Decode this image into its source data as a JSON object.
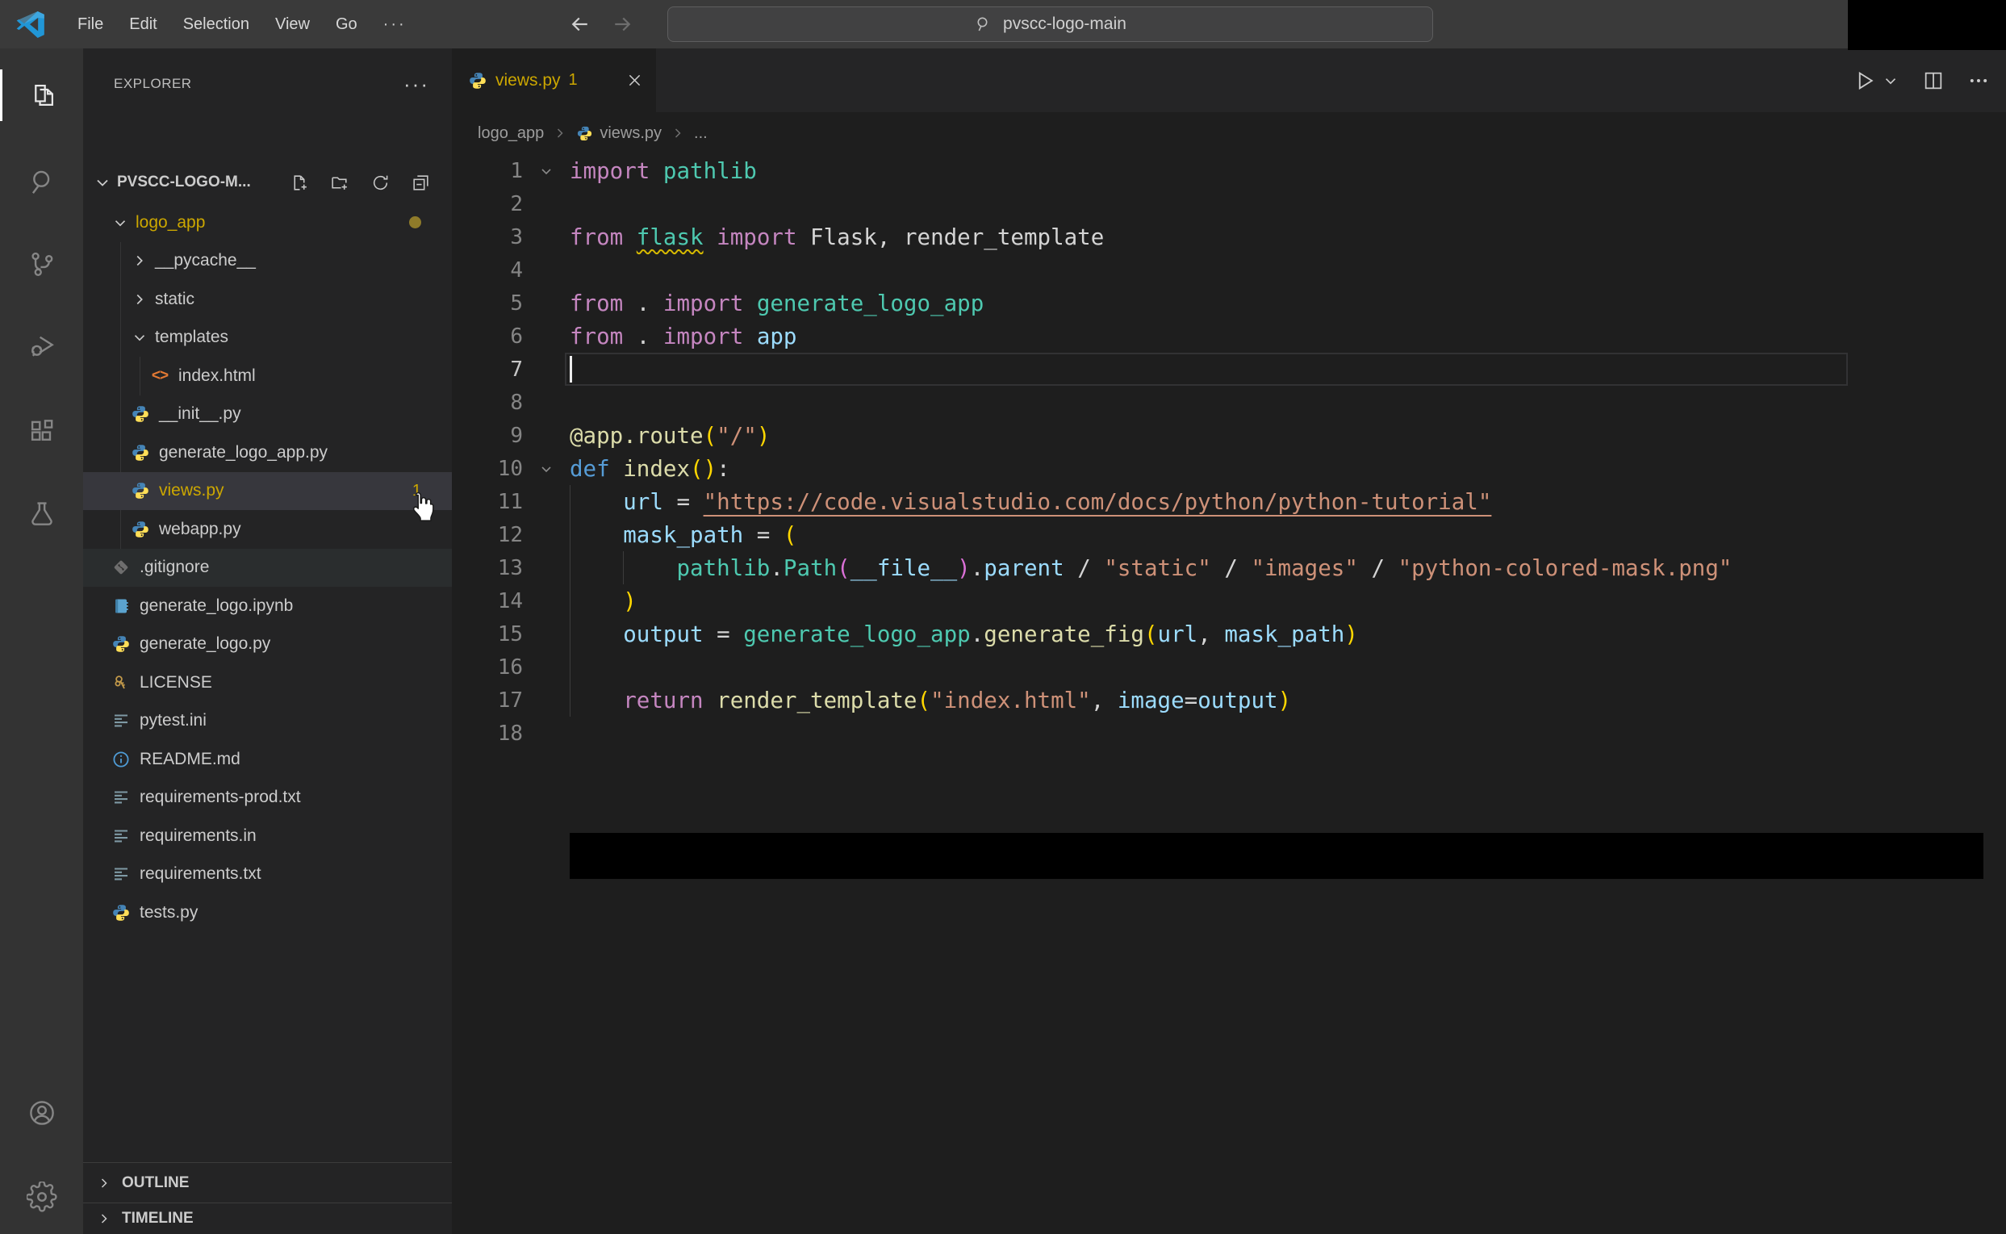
{
  "window": {
    "search_value": "pvscc-logo-main"
  },
  "title_bar": {
    "menus": [
      "File",
      "Edit",
      "Selection",
      "View",
      "Go"
    ],
    "overflow": "···",
    "icons": [
      "vscode-logo",
      "arrow-back",
      "arrow-forward",
      "search-icon"
    ]
  },
  "activity_bar": {
    "items": [
      {
        "id": "explorer",
        "icon": "files-icon",
        "active": true
      },
      {
        "id": "search",
        "icon": "search-icon",
        "active": false
      },
      {
        "id": "source-control",
        "icon": "source-control-icon",
        "active": false
      },
      {
        "id": "run-debug",
        "icon": "debug-icon",
        "active": false
      },
      {
        "id": "extensions",
        "icon": "extensions-icon",
        "active": false
      },
      {
        "id": "testing",
        "icon": "beaker-icon",
        "active": false
      }
    ],
    "bottom": [
      {
        "id": "account",
        "icon": "account-icon"
      },
      {
        "id": "settings",
        "icon": "gear-icon"
      }
    ]
  },
  "sidebar": {
    "header": {
      "title": "EXPLORER",
      "overflow": "···"
    },
    "root": {
      "label": "PVSCC-LOGO-M...",
      "actions": [
        "new-file",
        "new-folder",
        "refresh",
        "collapse-all"
      ]
    },
    "tree": [
      {
        "label": "logo_app",
        "depth": 1,
        "kind": "folder",
        "chevron": "down",
        "warn": true,
        "badge_dot": true
      },
      {
        "label": "__pycache__",
        "depth": 2,
        "kind": "folder",
        "chevron": "right"
      },
      {
        "label": "static",
        "depth": 2,
        "kind": "folder",
        "chevron": "right"
      },
      {
        "label": "templates",
        "depth": 2,
        "kind": "folder",
        "chevron": "down"
      },
      {
        "label": "index.html",
        "depth": 3,
        "icon": "html"
      },
      {
        "label": "__init__.py",
        "depth": 2,
        "icon": "python"
      },
      {
        "label": "generate_logo_app.py",
        "depth": 2,
        "icon": "python"
      },
      {
        "label": "views.py",
        "depth": 2,
        "icon": "python",
        "selected": true,
        "warn": true,
        "badge": "1"
      },
      {
        "label": "webapp.py",
        "depth": 2,
        "icon": "python"
      },
      {
        "label": ".gitignore",
        "depth": 1,
        "icon": "git",
        "hover": true
      },
      {
        "label": "generate_logo.ipynb",
        "depth": 1,
        "icon": "notebook"
      },
      {
        "label": "generate_logo.py",
        "depth": 1,
        "icon": "python"
      },
      {
        "label": "LICENSE",
        "depth": 1,
        "icon": "key"
      },
      {
        "label": "pytest.ini",
        "depth": 1,
        "icon": "list"
      },
      {
        "label": "README.md",
        "depth": 1,
        "icon": "info"
      },
      {
        "label": "requirements-prod.txt",
        "depth": 1,
        "icon": "list"
      },
      {
        "label": "requirements.in",
        "depth": 1,
        "icon": "list"
      },
      {
        "label": "requirements.txt",
        "depth": 1,
        "icon": "list"
      },
      {
        "label": "tests.py",
        "depth": 1,
        "icon": "python"
      }
    ],
    "sections": [
      {
        "label": "OUTLINE"
      },
      {
        "label": "TIMELINE"
      }
    ]
  },
  "editor": {
    "tab": {
      "label": "views.py",
      "badge": "1",
      "icon": "python"
    },
    "actions": [
      "run",
      "run-dropdown",
      "split-editor",
      "more-actions"
    ],
    "breadcrumb": [
      {
        "label": "logo_app"
      },
      {
        "label": "views.py",
        "icon": "python"
      },
      {
        "label": "..."
      }
    ],
    "code": {
      "cursor_line": 7,
      "lines": [
        {
          "n": 1,
          "fold": true,
          "tokens": [
            [
              "import",
              "kw"
            ],
            [
              " ",
              "pl"
            ],
            [
              "pathlib",
              "mod"
            ]
          ]
        },
        {
          "n": 2,
          "tokens": []
        },
        {
          "n": 3,
          "tokens": [
            [
              "from",
              "kw"
            ],
            [
              " ",
              "pl"
            ],
            [
              "flask",
              "modW"
            ],
            [
              " ",
              "pl"
            ],
            [
              "import",
              "kw"
            ],
            [
              " Flask, render_template",
              "pl"
            ]
          ]
        },
        {
          "n": 4,
          "tokens": []
        },
        {
          "n": 5,
          "tokens": [
            [
              "from",
              "kw"
            ],
            [
              " . ",
              "pl"
            ],
            [
              "import",
              "kw"
            ],
            [
              " ",
              "pl"
            ],
            [
              "generate_logo_app",
              "mod"
            ]
          ]
        },
        {
          "n": 6,
          "tokens": [
            [
              "from",
              "kw"
            ],
            [
              " . ",
              "pl"
            ],
            [
              "import",
              "kw"
            ],
            [
              " ",
              "pl"
            ],
            [
              "app",
              "var"
            ]
          ]
        },
        {
          "n": 7,
          "tokens": []
        },
        {
          "n": 8,
          "tokens": []
        },
        {
          "n": 9,
          "tokens": [
            [
              "@app.route",
              "dec"
            ],
            [
              "(",
              "b1"
            ],
            [
              "\"/\"",
              "str"
            ],
            [
              ")",
              "b1"
            ]
          ]
        },
        {
          "n": 10,
          "fold": true,
          "tokens": [
            [
              "def",
              "def"
            ],
            [
              " ",
              "pl"
            ],
            [
              "index",
              "fn"
            ],
            [
              "(",
              "b1"
            ],
            [
              ")",
              "b1"
            ],
            [
              ":",
              "pl"
            ]
          ]
        },
        {
          "n": 11,
          "tokens": [
            [
              "    ",
              "pl"
            ],
            [
              "url",
              "var"
            ],
            [
              " = ",
              "pl"
            ],
            [
              "\"https://code.visualstudio.com/docs/python/python-tutorial\"",
              "strU"
            ]
          ]
        },
        {
          "n": 12,
          "tokens": [
            [
              "    ",
              "pl"
            ],
            [
              "mask_path",
              "var"
            ],
            [
              " = ",
              "pl"
            ],
            [
              "(",
              "b1"
            ]
          ]
        },
        {
          "n": 13,
          "tokens": [
            [
              "        ",
              "pl"
            ],
            [
              "pathlib",
              "mod"
            ],
            [
              ".",
              "pl"
            ],
            [
              "Path",
              "mod"
            ],
            [
              "(",
              "b2"
            ],
            [
              "__file__",
              "var"
            ],
            [
              ")",
              "b2"
            ],
            [
              ".",
              "pl"
            ],
            [
              "parent",
              "var"
            ],
            [
              " / ",
              "pl"
            ],
            [
              "\"static\"",
              "str"
            ],
            [
              " / ",
              "pl"
            ],
            [
              "\"images\"",
              "str"
            ],
            [
              " / ",
              "pl"
            ],
            [
              "\"python-colored-mask.png\"",
              "str"
            ]
          ]
        },
        {
          "n": 14,
          "tokens": [
            [
              "    ",
              "pl"
            ],
            [
              ")",
              "b1"
            ]
          ]
        },
        {
          "n": 15,
          "tokens": [
            [
              "    ",
              "pl"
            ],
            [
              "output",
              "var"
            ],
            [
              " = ",
              "pl"
            ],
            [
              "generate_logo_app",
              "mod"
            ],
            [
              ".",
              "pl"
            ],
            [
              "generate_fig",
              "fn"
            ],
            [
              "(",
              "b1"
            ],
            [
              "url",
              "var"
            ],
            [
              ", ",
              "pl"
            ],
            [
              "mask_path",
              "var"
            ],
            [
              ")",
              "b1"
            ]
          ]
        },
        {
          "n": 16,
          "tokens": []
        },
        {
          "n": 17,
          "tokens": [
            [
              "    ",
              "pl"
            ],
            [
              "return",
              "kw"
            ],
            [
              " ",
              "pl"
            ],
            [
              "render_template",
              "fn"
            ],
            [
              "(",
              "b1"
            ],
            [
              "\"index.html\"",
              "str"
            ],
            [
              ", ",
              "pl"
            ],
            [
              "image",
              "var"
            ],
            [
              "=",
              "pl"
            ],
            [
              "output",
              "var"
            ],
            [
              ")",
              "b1"
            ]
          ]
        },
        {
          "n": 18,
          "tokens": []
        }
      ]
    }
  },
  "colors": {
    "titlebar": "#3a3a3a",
    "activitybar": "#333333",
    "sidebar": "#242425",
    "editor": "#1e1e1e",
    "tabstrip": "#252526",
    "selection": "#37373d",
    "warning": "#cca700",
    "keyword": "#c586c0",
    "module": "#4ec9b0",
    "variable": "#9cdcfe",
    "function": "#dcdcaa",
    "string": "#ce9178",
    "bracket_l1": "#ffd700",
    "bracket_l2": "#da70d6",
    "def_keyword": "#569cd6",
    "plain": "#d4d4d4"
  }
}
